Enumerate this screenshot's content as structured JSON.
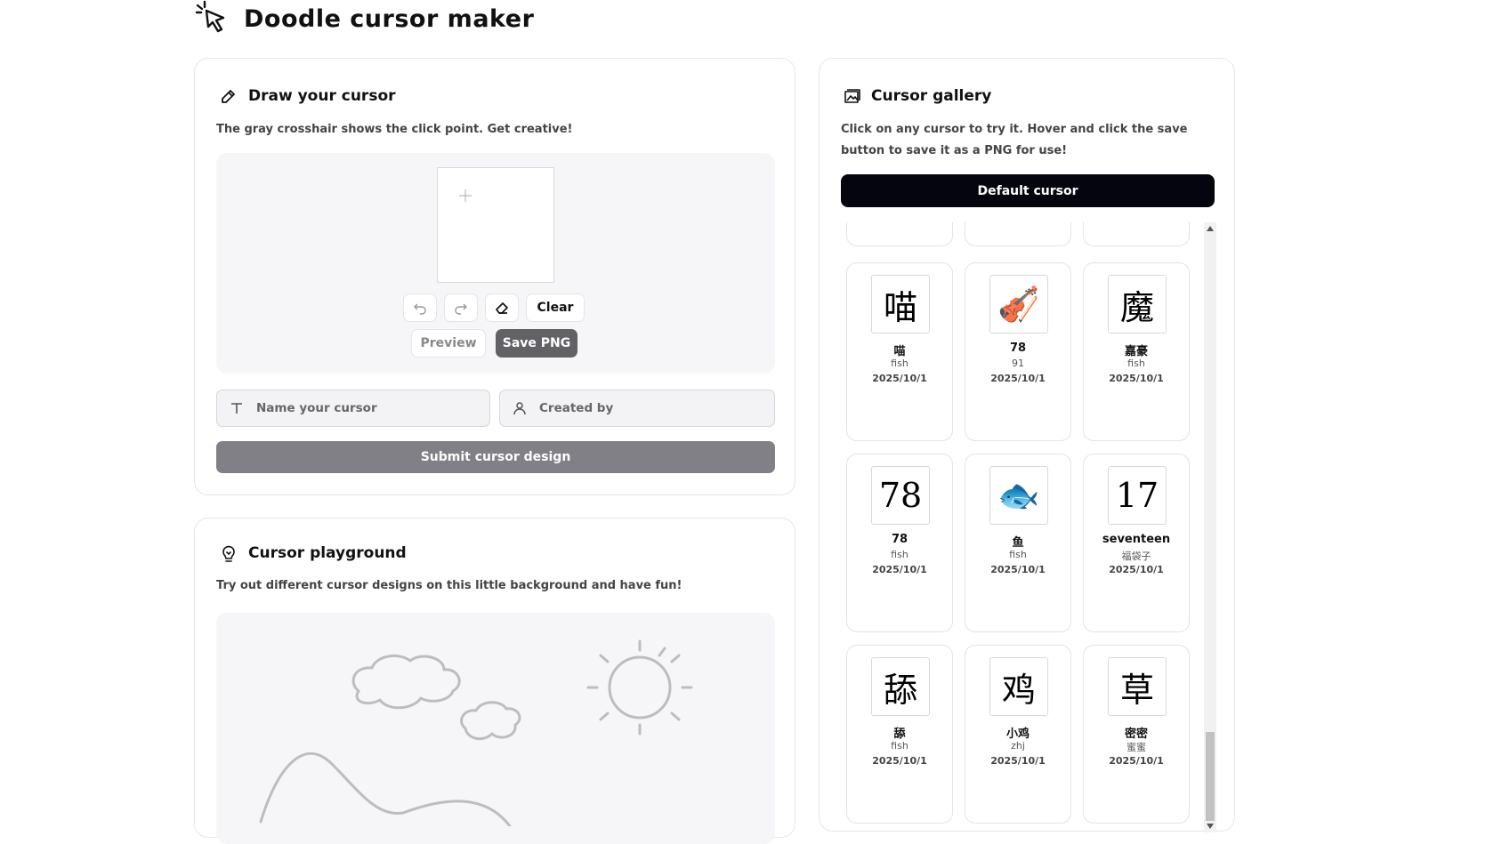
{
  "app": {
    "title": "Doodle cursor maker"
  },
  "draw": {
    "heading": "Draw your cursor",
    "description": "The gray crosshair shows the click point. Get creative!",
    "clear_label": "Clear",
    "preview_label": "Preview",
    "save_label": "Save PNG",
    "name_placeholder": "Name your cursor",
    "creator_placeholder": "Created by",
    "submit_label": "Submit cursor design"
  },
  "playground": {
    "heading": "Cursor playground",
    "description": "Try out different cursor designs on this little background and have fun!"
  },
  "gallery": {
    "heading": "Cursor gallery",
    "description_line1": "Click on any cursor to try it. Hover and click the save",
    "description_line2": "button to save it as a PNG for use!",
    "default_label": "Default cursor",
    "items": [
      {
        "glyph": "喵",
        "name": "喵",
        "author": "fish",
        "date": "2025/10/1"
      },
      {
        "glyph": "🎻",
        "name": "78",
        "author": "91",
        "date": "2025/10/1"
      },
      {
        "glyph": "魔",
        "name": "嘉豪",
        "author": "fish",
        "date": "2025/10/1"
      },
      {
        "glyph": "78",
        "name": "78",
        "author": "fish",
        "date": "2025/10/1"
      },
      {
        "glyph": "🐟",
        "name": "鱼",
        "author": "fish",
        "date": "2025/10/1"
      },
      {
        "glyph": "17",
        "name": "seventeen",
        "author": "福袋子",
        "date": "2025/10/1"
      },
      {
        "glyph": "舔",
        "name": "舔",
        "author": "fish",
        "date": "2025/10/1"
      },
      {
        "glyph": "鸡",
        "name": "小鸡",
        "author": "zhj",
        "date": "2025/10/1"
      },
      {
        "glyph": "草",
        "name": "密密",
        "author": "蜜蜜",
        "date": "2025/10/1"
      }
    ]
  },
  "colors": {
    "primary_dark": "#050510",
    "button_gray": "#616166",
    "submit_gray": "#808086",
    "border": "#e6e6ea"
  }
}
